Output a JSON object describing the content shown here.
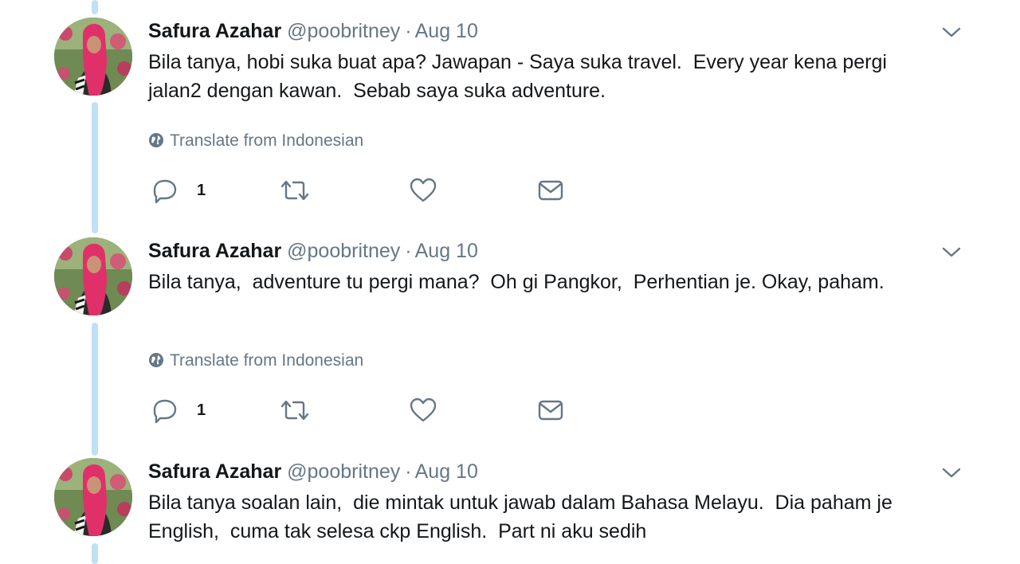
{
  "thread": {
    "tweets": [
      {
        "name": "Safura Azahar",
        "handle": "@poobritney",
        "separator": "·",
        "date": "Aug 10",
        "text": "Bila tanya, hobi suka buat apa? Jawapan - Saya suka travel.  Every year kena pergi jalan2 dengan kawan.  Sebab saya suka adventure.",
        "translate_label": "Translate from Indonesian",
        "reply_count": "1"
      },
      {
        "name": "Safura Azahar",
        "handle": "@poobritney",
        "separator": "·",
        "date": "Aug 10",
        "text": "Bila tanya,  adventure tu pergi mana?  Oh gi Pangkor,  Perhentian je. Okay, paham.",
        "translate_label": "Translate from Indonesian",
        "reply_count": "1"
      },
      {
        "name": "Safura Azahar",
        "handle": "@poobritney",
        "separator": "·",
        "date": "Aug 10",
        "text": "Bila tanya soalan lain,  die mintak untuk jawab dalam Bahasa Melayu.  Dia paham je English,  cuma tak selesa ckp English.  Part ni aku sedih"
      }
    ],
    "icons": {
      "avatar": "profile-photo",
      "caret": "chevron-down-icon",
      "translate": "globe-icon",
      "reply": "reply-icon",
      "retweet": "retweet-icon",
      "like": "heart-icon",
      "message": "envelope-icon"
    },
    "colors": {
      "thread_line": "#bfe0f5",
      "secondary_text": "#657786",
      "primary_text": "#14171a"
    }
  }
}
